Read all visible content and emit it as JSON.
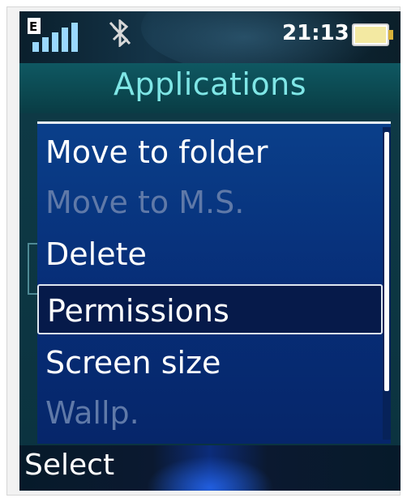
{
  "status": {
    "time": "21:13",
    "network_type": "E",
    "signal_icon": "signal-bars-icon",
    "bluetooth_icon": "bluetooth-off-icon",
    "battery_icon": "battery-icon"
  },
  "header": {
    "title": "Applications"
  },
  "menu": {
    "items": [
      {
        "label": "Move to folder",
        "state": "enabled"
      },
      {
        "label": "Move to M.S.",
        "state": "disabled"
      },
      {
        "label": "Delete",
        "state": "enabled"
      },
      {
        "label": "Permissions",
        "state": "selected"
      },
      {
        "label": "Screen size",
        "state": "enabled"
      },
      {
        "label": "Wallp.",
        "state": "disabled"
      }
    ]
  },
  "softkeys": {
    "left": "Select"
  },
  "colors": {
    "title_text": "#7fe6e6",
    "menu_bg": "#072e78",
    "selected_bg": "#061a4a",
    "disabled_text": "#5f79a8"
  }
}
